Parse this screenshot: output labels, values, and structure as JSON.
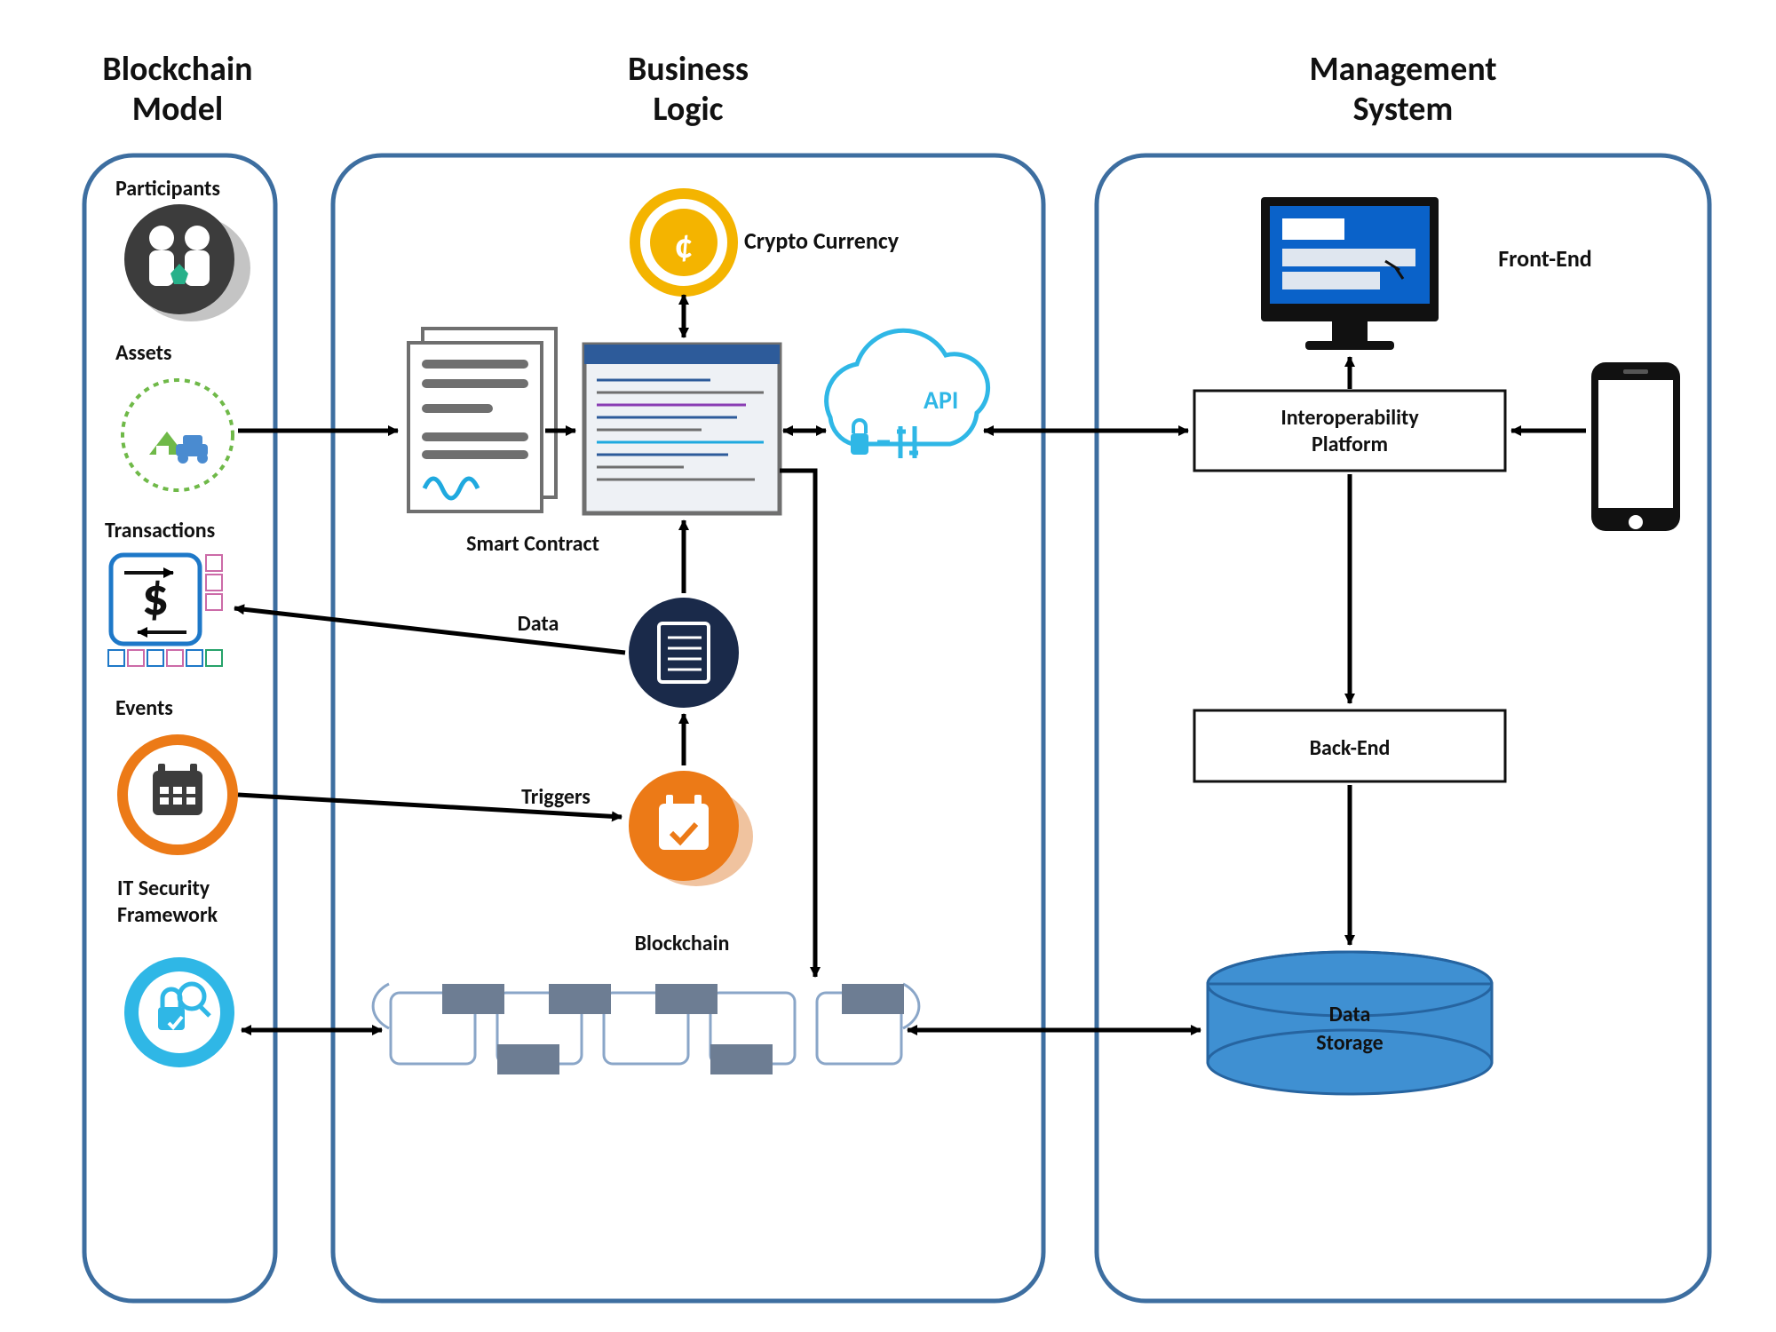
{
  "columns": {
    "blockchainModel": {
      "title1": "Blockchain",
      "title2": "Model"
    },
    "businessLogic": {
      "title1": "Business",
      "title2": "Logic"
    },
    "managementSystem": {
      "title1": "Management",
      "title2": "System"
    }
  },
  "blockchainModel": {
    "participants": "Participants",
    "assets": "Assets",
    "transactions": "Transactions",
    "events": "Events",
    "itSecurity1": "IT Security",
    "itSecurity2": "Framework"
  },
  "businessLogic": {
    "cryptoCurrency": "Crypto Currency",
    "smartContract": "Smart Contract",
    "data": "Data",
    "triggers": "Triggers",
    "blockchain": "Blockchain",
    "api": "API"
  },
  "managementSystem": {
    "frontEnd": "Front-End",
    "interoperability1": "Interoperability",
    "interoperability2": "Platform",
    "backEnd": "Back-End",
    "dataStorage1": "Data",
    "dataStorage2": "Storage"
  },
  "colors": {
    "columnBorder": "#3d6ea0",
    "arrow": "#000",
    "orange": "#ec7a17",
    "darkNavy": "#1a2a4a",
    "skyBlue": "#2fb7e6",
    "yellowCoin": "#f4b400",
    "dbBlue": "#3f90d2",
    "docGray": "#6f6f6f",
    "greenDash": "#6fb948",
    "participantGray": "#3c3c3c"
  }
}
